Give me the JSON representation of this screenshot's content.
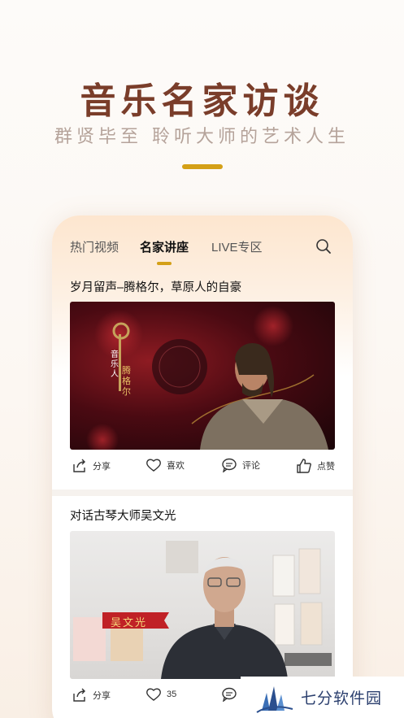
{
  "hero": {
    "title": "音乐名家访谈",
    "subtitle": "群贤毕至 聆听大师的艺术人生"
  },
  "tabs": [
    {
      "label": "热门视频",
      "active": false
    },
    {
      "label": "名家讲座",
      "active": true
    },
    {
      "label": "LIVE专区",
      "active": false
    }
  ],
  "posts": [
    {
      "title": "岁月留声–腾格尔，草原人的自豪",
      "overlay_caption": [
        "音",
        "乐",
        "人",
        "腾",
        "格",
        "尔"
      ],
      "actions": {
        "share": "分享",
        "like": "喜欢",
        "comment": "评论",
        "thumb": "点赞"
      }
    },
    {
      "title": "对话古琴大师吴文光",
      "name_banner": "吴文光",
      "actions": {
        "share": "分享",
        "like": "35"
      }
    }
  ],
  "watermark": {
    "text": "七分软件园"
  },
  "colors": {
    "accent": "#d4a017",
    "title": "#7a3d2a",
    "subtitle": "#b5a39a"
  }
}
